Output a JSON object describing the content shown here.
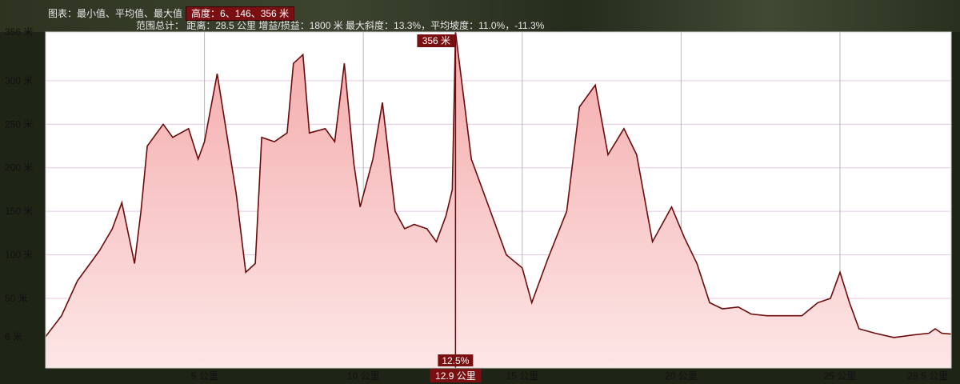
{
  "header": {
    "chart_label": "图表：最小值、平均值、最大值",
    "altitude_badge": "高度：6、146、356 米",
    "range_summary": "范围总计：  距离：28.5 公里 增益/损益：1800 米  最大斜度：13.3%，平均坡度：11.0%，-11.3%"
  },
  "markers": {
    "peak_label": "356 米",
    "slope_label": "12.5%",
    "cursor_distance_label": "12.9 公里"
  },
  "colors": {
    "plot_background": "#ffffff",
    "grid": "#e8c6e6",
    "area_fill_top": "#f3a9aa",
    "area_fill_bottom": "#fde6e6",
    "line": "#6b0a0a",
    "marker_fill": "#7a0f12",
    "frame": "#cfcfcf"
  },
  "chart_data": {
    "type": "area",
    "title": "",
    "xlabel": "",
    "ylabel": "",
    "x_unit": "公里",
    "y_unit": "米",
    "xlim": [
      0,
      28.5
    ],
    "ylim": [
      -30,
      356
    ],
    "yticks": [
      6,
      50,
      100,
      150,
      200,
      250,
      300,
      356
    ],
    "ytick_labels": [
      "6 米",
      "50 米",
      "100 米",
      "150 米",
      "200 米",
      "250 米",
      "300 米",
      "356 米"
    ],
    "xticks": [
      5,
      10,
      15,
      20,
      25,
      28.5
    ],
    "xtick_labels": [
      "5 公里",
      "10 公里",
      "15 公里",
      "20 公里",
      "25 公里",
      "28.5 公里"
    ],
    "cursor_x": 12.9,
    "x": [
      0,
      0.5,
      1,
      1.5,
      1.7,
      2.1,
      2.4,
      2.8,
      3.0,
      3.2,
      3.7,
      4.0,
      4.5,
      4.8,
      5.0,
      5.4,
      6.0,
      6.3,
      6.6,
      6.8,
      7.2,
      7.6,
      7.8,
      8.1,
      8.3,
      8.8,
      9.1,
      9.4,
      9.7,
      9.9,
      10.3,
      10.6,
      11.0,
      11.3,
      11.6,
      12.0,
      12.3,
      12.6,
      12.8,
      12.9,
      13.4,
      14.0,
      14.5,
      15.0,
      15.3,
      15.8,
      16.4,
      16.8,
      17.3,
      17.7,
      18.2,
      18.6,
      19.1,
      19.7,
      20.1,
      20.5,
      20.9,
      21.3,
      21.8,
      22.2,
      22.7,
      23.2,
      23.8,
      24.3,
      24.7,
      25.0,
      25.3,
      25.6,
      26.1,
      26.7,
      27.3,
      27.8,
      28.0,
      28.2,
      28.5
    ],
    "values": [
      6,
      30,
      70,
      95,
      105,
      130,
      160,
      90,
      150,
      225,
      250,
      235,
      245,
      210,
      230,
      308,
      170,
      80,
      90,
      235,
      230,
      240,
      320,
      330,
      240,
      245,
      230,
      320,
      205,
      155,
      210,
      275,
      150,
      130,
      135,
      130,
      115,
      145,
      175,
      356,
      210,
      150,
      100,
      85,
      45,
      95,
      150,
      270,
      295,
      215,
      245,
      215,
      115,
      155,
      120,
      90,
      45,
      38,
      40,
      32,
      30,
      30,
      30,
      45,
      50,
      80,
      45,
      15,
      10,
      5,
      8,
      10,
      15,
      10,
      9
    ]
  }
}
